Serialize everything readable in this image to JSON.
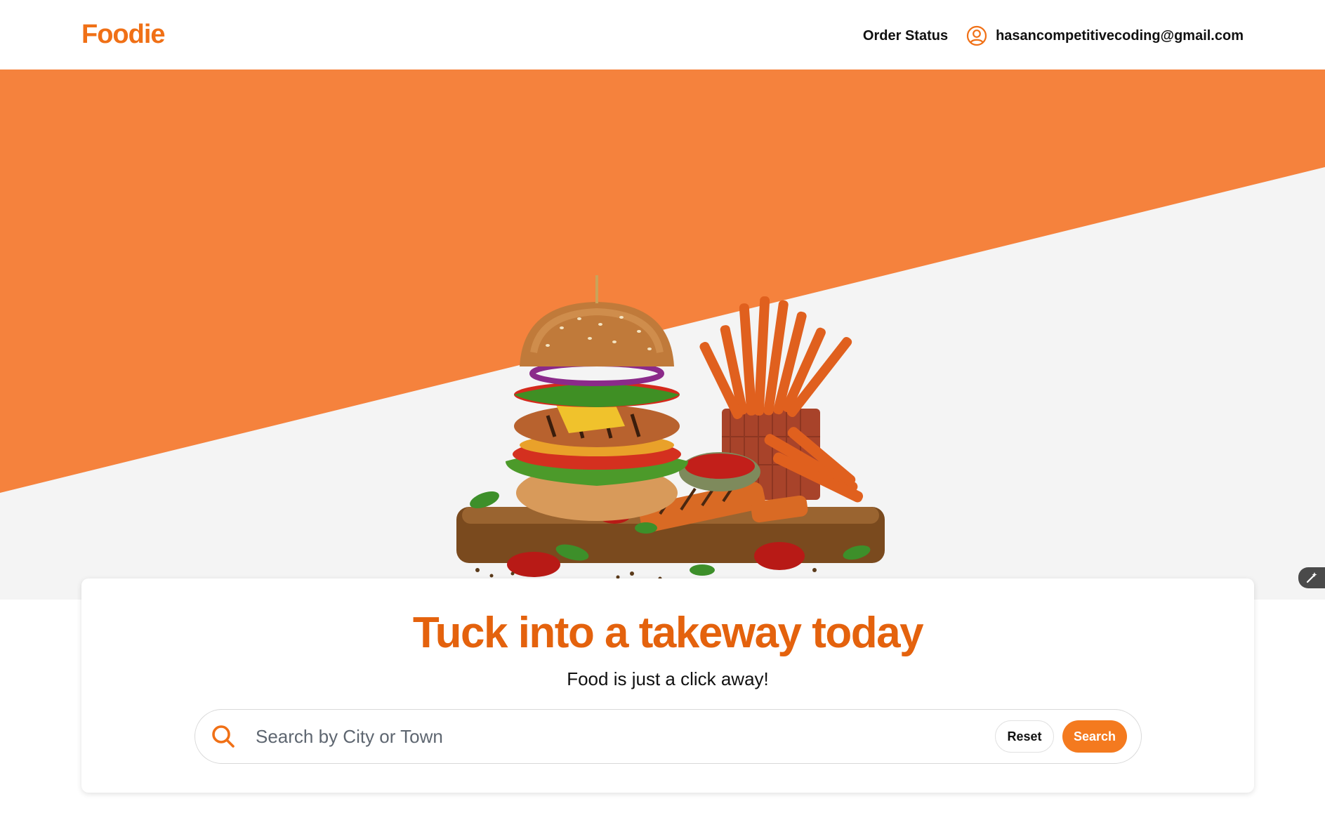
{
  "header": {
    "logo": "Foodie",
    "nav": {
      "order_status": "Order Status",
      "user_email": "hasancompetitivecoding@gmail.com",
      "user_icon": "user-circle-icon"
    }
  },
  "hero": {
    "image": "burger-and-fries-illustration",
    "edit_icon": "magic-wand-icon"
  },
  "search_card": {
    "headline": "Tuck into a takeway today",
    "subtitle": "Food is just a click away!",
    "search": {
      "icon": "search-icon",
      "placeholder": "Search by City or Town",
      "value": ""
    },
    "reset_label": "Reset",
    "search_label": "Search"
  },
  "colors": {
    "brand": "#f07016",
    "hero_orange": "#f5823d",
    "hero_light": "#f4f4f4",
    "headline": "#e4620d",
    "button": "#f47a1f"
  }
}
